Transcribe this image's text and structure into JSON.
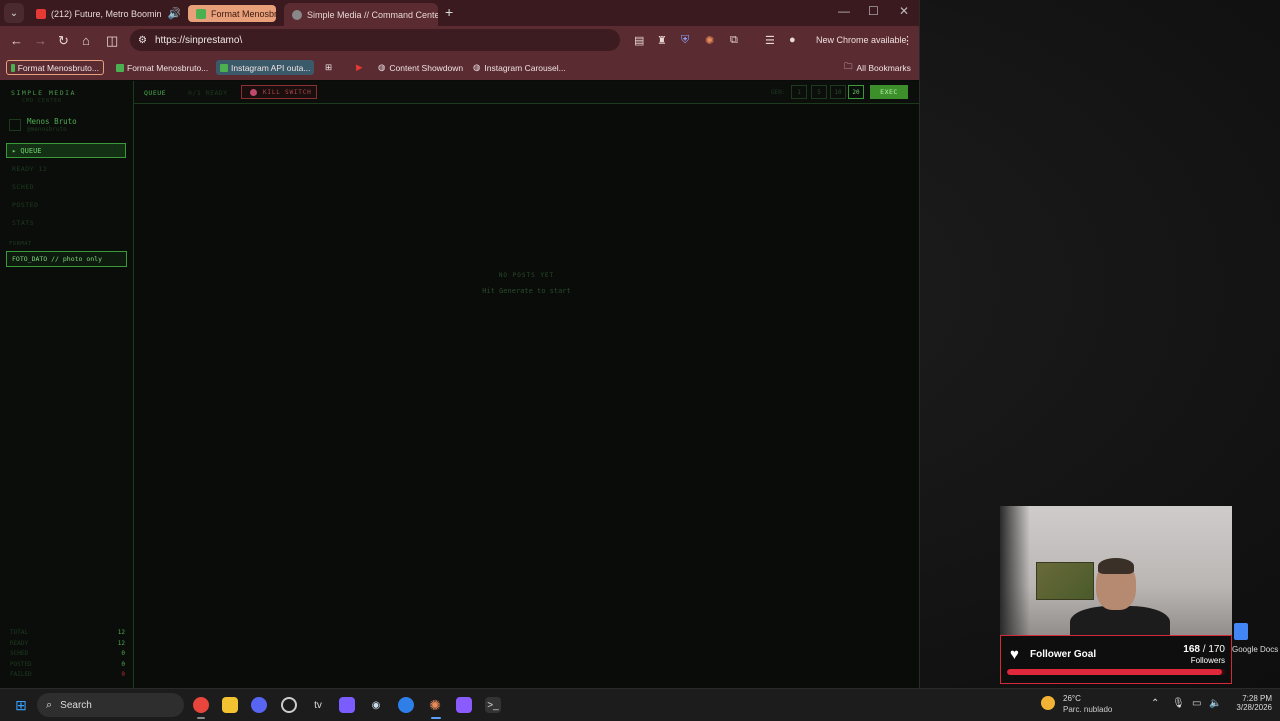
{
  "browser": {
    "tabs": [
      {
        "label": "(212) Future, Metro Boomin"
      },
      {
        "label": "Format Menosbruto"
      },
      {
        "label": "Simple Media // Command Center"
      }
    ],
    "url": "https://sinprestamo\\",
    "new_chrome": "New Chrome available",
    "bookmarks": [
      {
        "label": "Format Menosbruto..."
      },
      {
        "label": "Format Menosbruto..."
      },
      {
        "label": "Instagram API outa..."
      },
      {
        "label": "Content Showdown"
      },
      {
        "label": "Instagram Carousel..."
      }
    ],
    "all_bookmarks": "All Bookmarks"
  },
  "app": {
    "brand": "SIMPLE MEDIA",
    "brand_sub": "CMD CENTER",
    "account": {
      "name": "Menos Bruto",
      "handle": "@menosbruto"
    },
    "nav": [
      {
        "label": "▸ QUEUE"
      },
      {
        "label": "READY  12"
      },
      {
        "label": "SCHED"
      },
      {
        "label": "POSTED"
      },
      {
        "label": "STATS"
      }
    ],
    "format_header": "FORMAT",
    "format_value": "FOTO_DATO // photo only",
    "stats": [
      {
        "key": "TOTAL",
        "value": "12",
        "color": "#4fae4f"
      },
      {
        "key": "READY",
        "value": "12",
        "color": "#4fae4f"
      },
      {
        "key": "SCHED",
        "value": "0",
        "color": "#4fae4f"
      },
      {
        "key": "POSTED",
        "value": "0",
        "color": "#4fae4f"
      },
      {
        "key": "FAILED",
        "value": "0",
        "color": "#b03030"
      }
    ],
    "topbar": {
      "queue_tab": "QUEUE",
      "ready_tab": "0/1 READY",
      "kill_switch": "KILL SWITCH",
      "gen_label": "GEN:",
      "gen_options": [
        "1",
        "5",
        "10",
        "20"
      ],
      "exec": "EXEC"
    },
    "empty": {
      "title": "NO POSTS YET",
      "subtitle": "Hit Generate to start"
    }
  },
  "overlay": {
    "follower_goal": {
      "label": "Follower Goal",
      "current": "168",
      "target": "170",
      "unit": "Followers",
      "progress": 0.988
    },
    "desktop_icon": "Google Docs"
  },
  "taskbar": {
    "search": "Search",
    "weather": {
      "temp": "26°C",
      "desc": "Parc. nublado"
    },
    "time": "7:28 PM",
    "date": "3/28/2026"
  },
  "colors": {
    "accent": "#3d8f2c",
    "kill": "#b04848",
    "goal": "#e0283c"
  }
}
